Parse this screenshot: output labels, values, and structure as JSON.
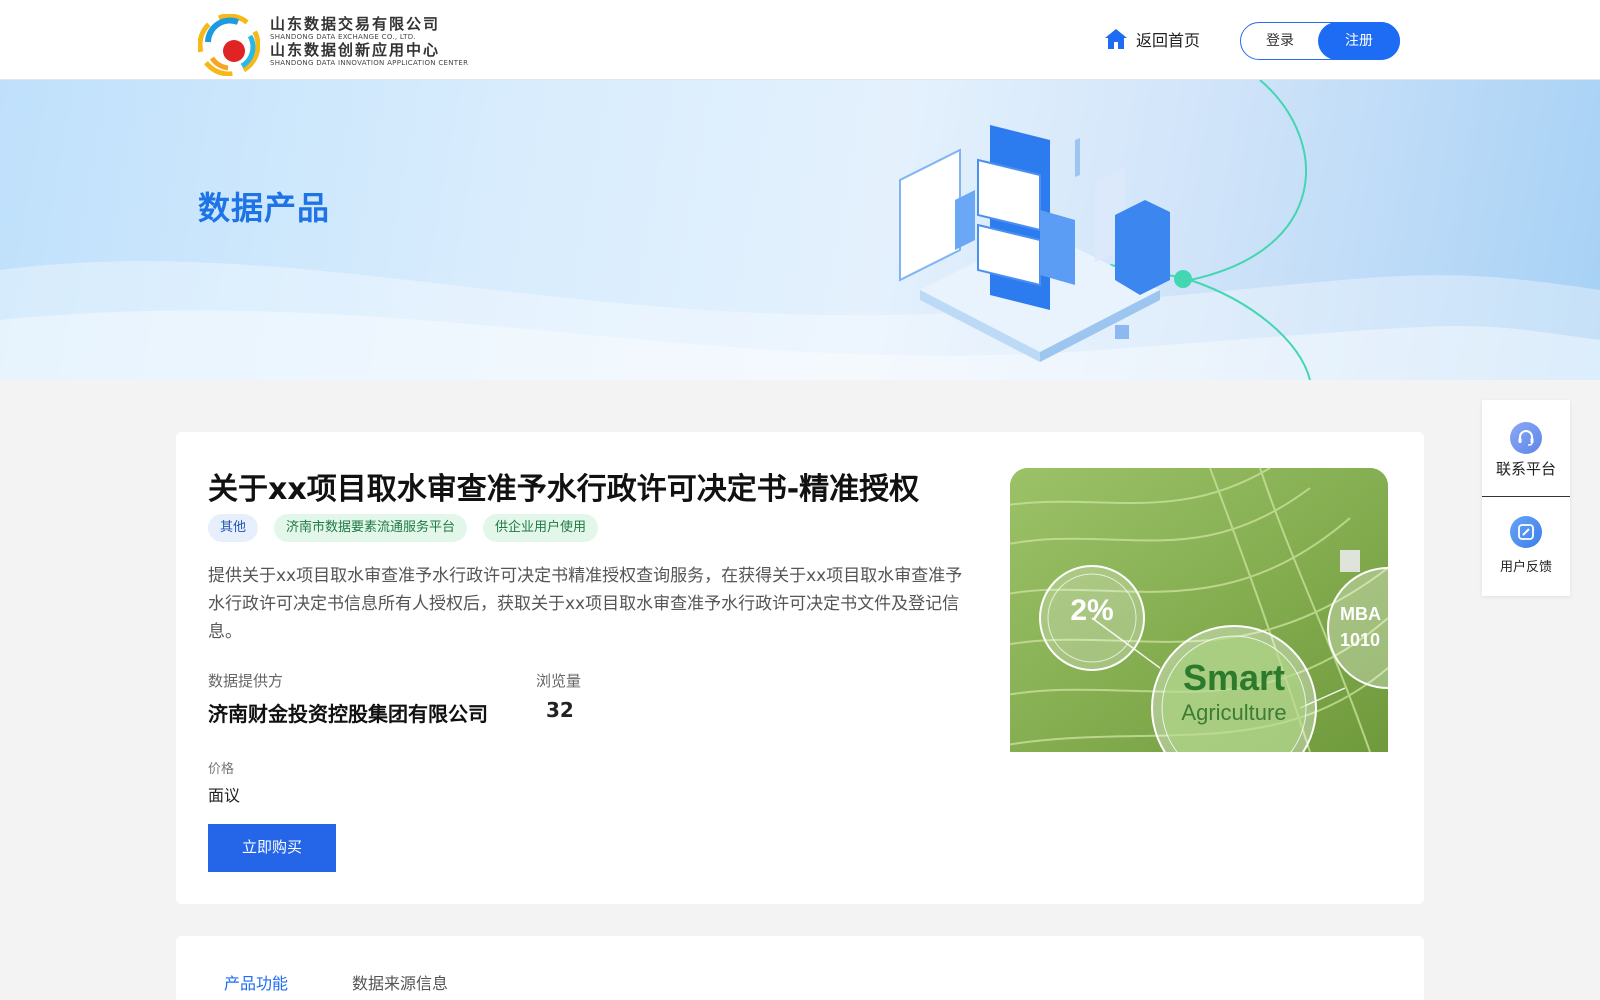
{
  "header": {
    "logo": {
      "line1_cn": "山东数据交易有限公司",
      "line1_en": "SHANDONG DATA EXCHANGE CO., LTD.",
      "line2_cn": "山东数据创新应用中心",
      "line2_en": "SHANDONG DATA INNOVATION APPLICATION CENTER"
    },
    "home_label": "返回首页",
    "login_label": "登录",
    "register_label": "注册"
  },
  "banner": {
    "title": "数据产品"
  },
  "product": {
    "title": "关于xx项目取水审查准予水行政许可决定书-精准授权",
    "tags": [
      "其他",
      "济南市数据要素流通服务平台",
      "供企业用户使用"
    ],
    "description": "提供关于xx项目取水审查准予水行政许可决定书精准授权查询服务，在获得关于xx项目取水审查准予水行政许可决定书信息所有人授权后，获取关于xx项目取水审查准予水行政许可决定书文件及登记信息。",
    "provider_label": "数据提供方",
    "provider_value": "济南财金投资控股集团有限公司",
    "views_label": "浏览量",
    "views_value": "32",
    "price_label": "价格",
    "price_value": "面议",
    "buy_label": "立即购买",
    "image": {
      "percent_text": "2%",
      "title_text": "Smart",
      "subtitle_text": "Agriculture",
      "side_text_1": "MBA",
      "side_text_2": "1010"
    }
  },
  "tabs": [
    "产品功能",
    "数据来源信息"
  ],
  "side_panel": {
    "contact_label": "联系平台",
    "feedback_label": "用户反馈"
  },
  "colors": {
    "brand_blue": "#1f6cf4",
    "banner_title": "#1e74e6",
    "buy_button": "#2566e8"
  },
  "icons": {
    "home": "home-icon",
    "contact": "headset-icon",
    "feedback": "edit-icon"
  }
}
